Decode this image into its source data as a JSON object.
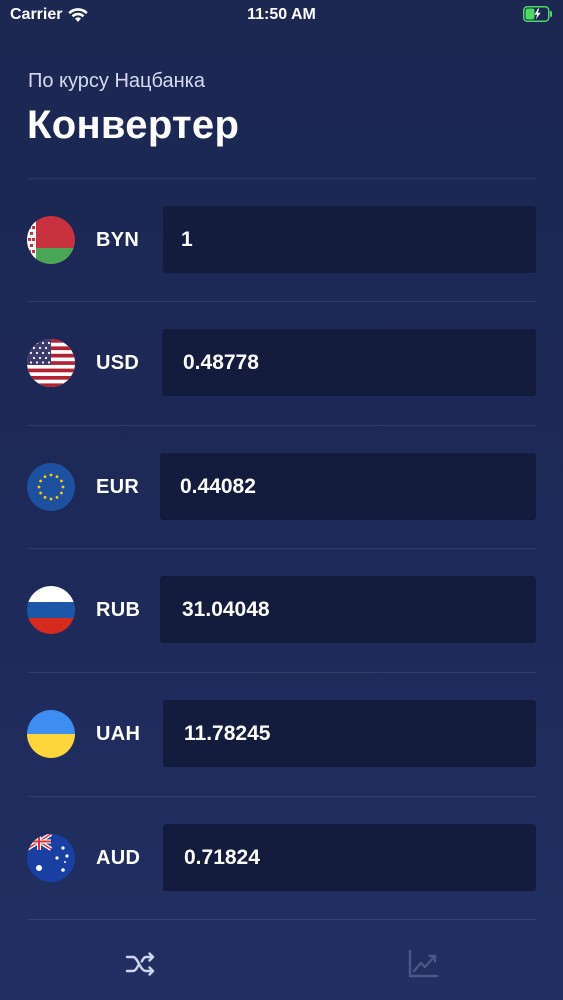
{
  "status_bar": {
    "carrier": "Carrier",
    "time": "11:50 AM",
    "wifi_icon": "wifi-icon",
    "battery_icon": "battery-charging-icon"
  },
  "header": {
    "subtitle": "По курсу Нацбанка",
    "title": "Конвертер"
  },
  "currencies": [
    {
      "code": "BYN",
      "value": "1",
      "flag": "flag-belarus-icon"
    },
    {
      "code": "USD",
      "value": "0.48778",
      "flag": "flag-usa-icon"
    },
    {
      "code": "EUR",
      "value": "0.44082",
      "flag": "flag-eu-icon"
    },
    {
      "code": "RUB",
      "value": "31.04048",
      "flag": "flag-russia-icon"
    },
    {
      "code": "UAH",
      "value": "11.78245",
      "flag": "flag-ukraine-icon"
    },
    {
      "code": "AUD",
      "value": "0.71824",
      "flag": "flag-australia-icon"
    }
  ],
  "tab_bar": {
    "tabs": [
      {
        "icon": "shuffle-icon",
        "active": true
      },
      {
        "icon": "chart-icon",
        "active": false
      }
    ]
  },
  "colors": {
    "background": "#1d2958",
    "field": "#141c3d",
    "battery": "#4cd964",
    "tab_active": "#cfd5ea",
    "tab_inactive": "#4a5684"
  }
}
